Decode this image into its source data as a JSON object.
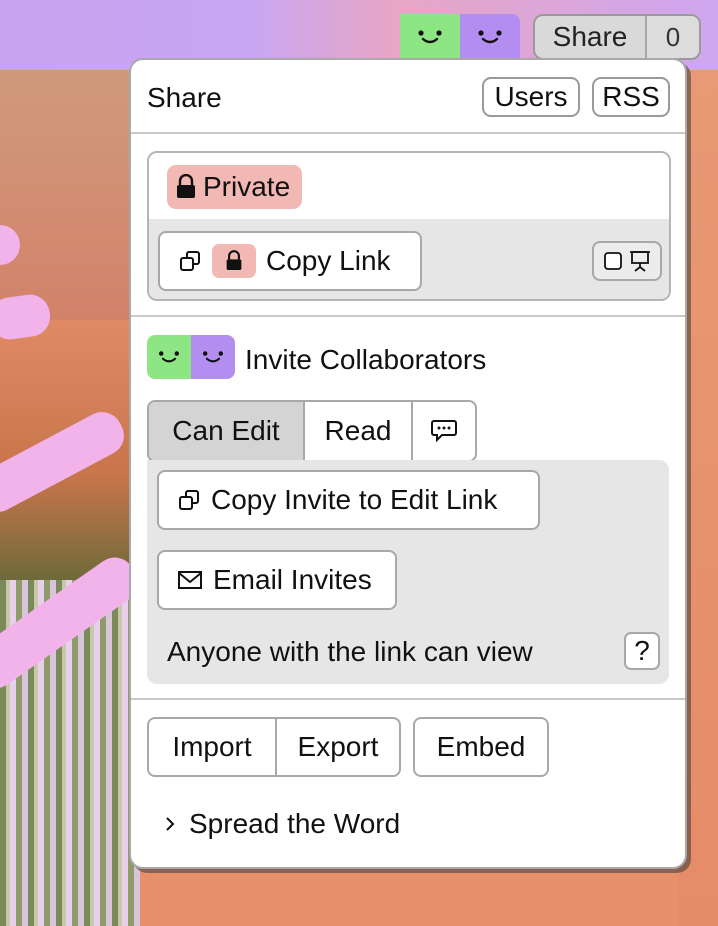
{
  "topbar": {
    "share_label": "Share",
    "count": "0"
  },
  "panel": {
    "title": "Share",
    "users_button": "Users",
    "rss_button": "RSS",
    "access": {
      "private_label": "Private",
      "copy_link_label": "Copy Link"
    },
    "invite": {
      "heading": "Invite Collaborators",
      "tabs": [
        "Can Edit",
        "Read"
      ],
      "active_tab": "Can Edit",
      "copy_invite_label": "Copy Invite to Edit Link",
      "email_invites_label": "Email Invites",
      "note": "Anyone with the link can view",
      "help_label": "?"
    },
    "actions": {
      "import_label": "Import",
      "export_label": "Export",
      "embed_label": "Embed"
    },
    "spread_label": "Spread the Word"
  },
  "colors": {
    "avatar_green": "#8de683",
    "avatar_purple": "#b48df0",
    "private_tag": "#f2b8b4",
    "panel_grey": "#e6e6e6"
  },
  "icons": [
    "smiley-face-icon",
    "lock-icon",
    "copy-icon",
    "present-icon",
    "comment-icon",
    "envelope-icon",
    "chevron-right-icon"
  ]
}
